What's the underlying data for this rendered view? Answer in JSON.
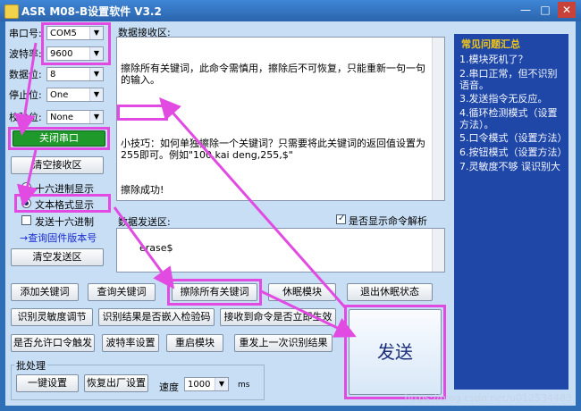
{
  "window": {
    "title": "ASR M08-B设置软件 V3.2",
    "min_glyph": "—",
    "max_glyph": "□",
    "close_glyph": "✕"
  },
  "serial": {
    "port_label": "串口号:",
    "port_value": "COM5",
    "baud_label": "波特率:",
    "baud_value": "9600",
    "databits_label": "数据位:",
    "databits_value": "8",
    "stopbits_label": "停止位:",
    "stopbits_value": "One",
    "parity_label": "校验位:",
    "parity_value": "None",
    "close_port": "关闭串口",
    "clear_recv": "清空接收区",
    "hex_display": "十六进制显示",
    "text_display": "文本格式显示",
    "send_hex": "发送十六进制",
    "query_firmware": "→查询固件版本号",
    "clear_send": "清空发送区"
  },
  "receive": {
    "label": "数据接收区:",
    "line1": "擦除所有关键词，此命令需慎用，擦除后不可恢复，只能重新一句一句的输入。",
    "line2": "小技巧：如何单独擦除一个关键词？只需要将此关键词的返回值设置为255即可。例如\"100,kai deng,255,$\"",
    "line3": "擦除成功!"
  },
  "send": {
    "label": "数据发送区:",
    "show_parse": "是否显示命令解析",
    "value": "erase$",
    "send_button": "发送"
  },
  "buttons": {
    "row1": [
      "添加关键词",
      "查询关键词",
      "擦除所有关键词",
      "休眠模块",
      "退出休眠状态"
    ],
    "row2": [
      "识别灵敏度调节",
      "识别结果是否嵌入检验码",
      "接收到命令是否立即生效"
    ],
    "row3": [
      "是否允许口令触发",
      "波特率设置",
      "重启模块",
      "重发上一次识别结果"
    ]
  },
  "batch": {
    "title": "批处理",
    "one_key": "一键设置",
    "factory": "恢复出厂设置",
    "speed_label": "速度",
    "speed_value": "1000",
    "speed_unit": "ms"
  },
  "faq": {
    "title": "常见问题汇总",
    "items": [
      "1.模块死机了？",
      "2.串口正常，但不识别语音。",
      "3.发送指令无反应。",
      "4.循环检测模式（设置方法）。",
      "5.口令模式（设置方法）",
      "6.按钮模式（设置方法）",
      "7.灵敏度不够 误识别大"
    ]
  },
  "watermark": "https://blog.csdn.net/u012534483",
  "colors": {
    "accent_highlight": "#e14be2",
    "title_bar": "#2f6fb8",
    "faq_bg": "#1f47a8",
    "faq_title": "#f0c418",
    "close_port_bg": "#1f9a2a"
  }
}
